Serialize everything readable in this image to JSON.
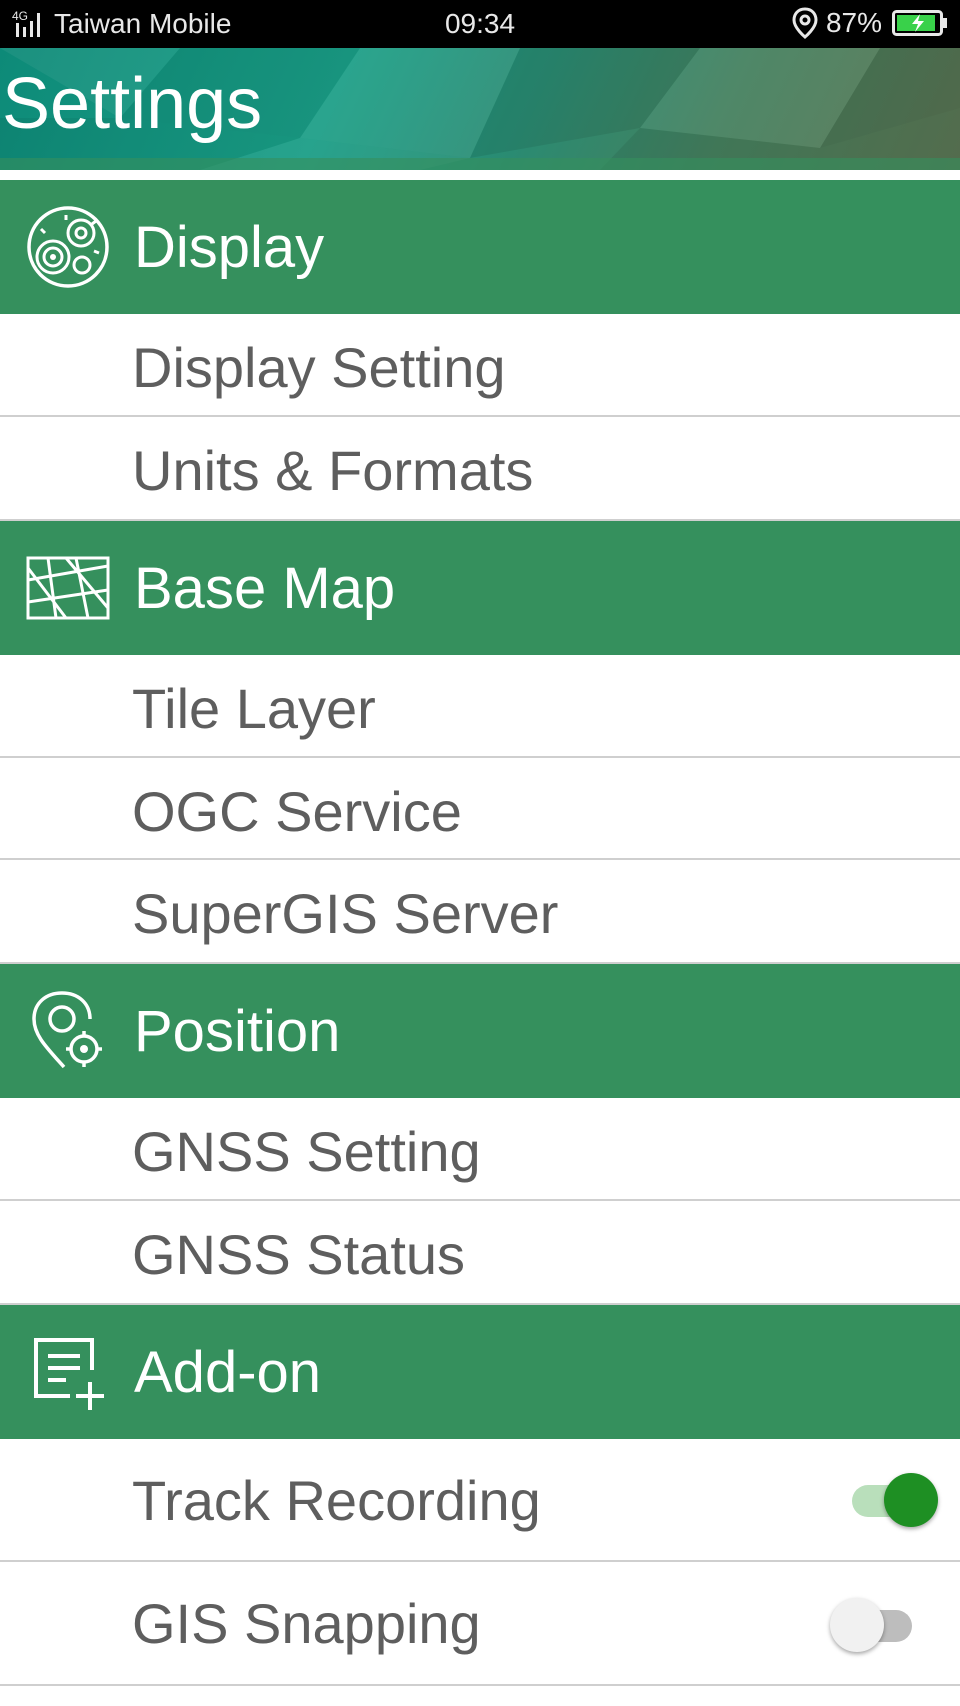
{
  "status_bar": {
    "network": "4G",
    "carrier": "Taiwan Mobile",
    "time": "09:34",
    "battery": "87%"
  },
  "header": {
    "title": "Settings"
  },
  "sections": [
    {
      "label": "Display",
      "icon": "gear-disc-icon",
      "items": [
        {
          "label": "Display Setting"
        },
        {
          "label": "Units & Formats"
        }
      ]
    },
    {
      "label": "Base Map",
      "icon": "map-icon",
      "items": [
        {
          "label": "Tile Layer"
        },
        {
          "label": "OGC Service"
        },
        {
          "label": "SuperGIS Server"
        }
      ]
    },
    {
      "label": "Position",
      "icon": "location-target-icon",
      "items": [
        {
          "label": "GNSS Setting"
        },
        {
          "label": "GNSS Status"
        }
      ]
    },
    {
      "label": "Add-on",
      "icon": "list-add-icon",
      "items": [
        {
          "label": "Track Recording",
          "toggle": true
        },
        {
          "label": "GIS Snapping",
          "toggle": false
        }
      ]
    }
  ],
  "colors": {
    "section": "#35905d",
    "toggle_on": "#1e8f23",
    "toggle_on_track": "#b9dfbb",
    "toggle_off_track": "#bdbdbd",
    "toggle_off_thumb": "#f1f1f1"
  }
}
